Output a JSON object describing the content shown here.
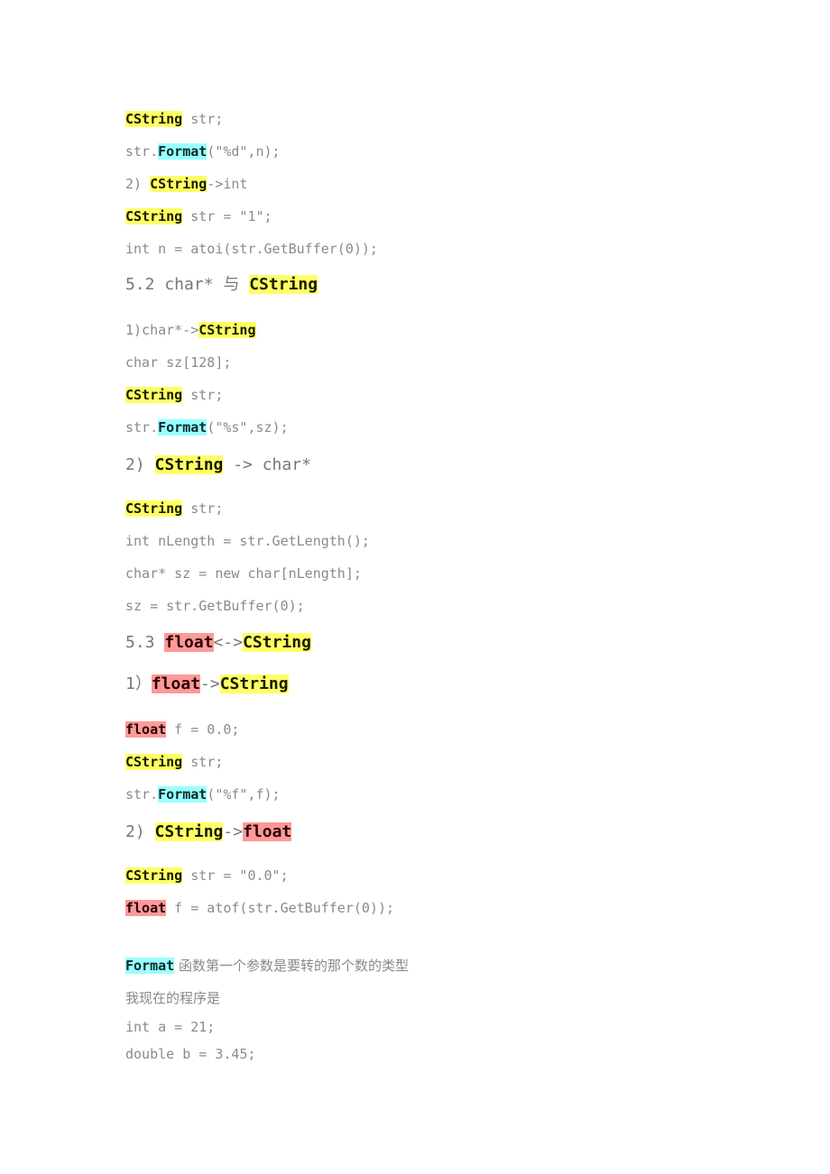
{
  "colors": {
    "cstring": "#ffff66",
    "format": "#99ffff",
    "float": "#ff9999",
    "text": "#8a8a8a"
  },
  "lines": [
    {
      "kind": "code",
      "segs": [
        {
          "t": "CString",
          "hl": "y"
        },
        {
          "t": " str;"
        }
      ]
    },
    {
      "kind": "code",
      "segs": [
        {
          "t": "str."
        },
        {
          "t": "Format",
          "hl": "c"
        },
        {
          "t": "(\"%d\",n);"
        }
      ]
    },
    {
      "kind": "code",
      "segs": [
        {
          "t": "2) "
        },
        {
          "t": "CString",
          "hl": "y"
        },
        {
          "t": "->int"
        }
      ]
    },
    {
      "kind": "code",
      "segs": [
        {
          "t": "CString",
          "hl": "y"
        },
        {
          "t": " str = \"1\";"
        }
      ]
    },
    {
      "kind": "code",
      "segs": [
        {
          "t": "int n = atoi(str.GetBuffer(0));"
        }
      ]
    },
    {
      "kind": "head",
      "segs": [
        {
          "t": "5.2 char* 与 "
        },
        {
          "t": "CString",
          "hl": "y"
        }
      ]
    },
    {
      "kind": "code",
      "segs": [
        {
          "t": "1)char*->"
        },
        {
          "t": "CString",
          "hl": "y"
        }
      ]
    },
    {
      "kind": "code",
      "segs": [
        {
          "t": "char sz[128];"
        }
      ]
    },
    {
      "kind": "code",
      "segs": [
        {
          "t": "CString",
          "hl": "y"
        },
        {
          "t": " str;"
        }
      ]
    },
    {
      "kind": "code",
      "segs": [
        {
          "t": "str."
        },
        {
          "t": "Format",
          "hl": "c"
        },
        {
          "t": "(\"%s\",sz);"
        }
      ]
    },
    {
      "kind": "head",
      "segs": [
        {
          "t": "2) "
        },
        {
          "t": "CString",
          "hl": "y"
        },
        {
          "t": " -> char*"
        }
      ]
    },
    {
      "kind": "code",
      "segs": [
        {
          "t": "CString",
          "hl": "y"
        },
        {
          "t": " str;"
        }
      ]
    },
    {
      "kind": "code",
      "segs": [
        {
          "t": "int nLength = str.GetLength();"
        }
      ]
    },
    {
      "kind": "code",
      "segs": [
        {
          "t": "char* sz = new char[nLength];"
        }
      ]
    },
    {
      "kind": "code",
      "segs": [
        {
          "t": "sz = str.GetBuffer(0);"
        }
      ]
    },
    {
      "kind": "head",
      "segs": [
        {
          "t": "5.3 "
        },
        {
          "t": "float",
          "hl": "r"
        },
        {
          "t": "<->"
        },
        {
          "t": "CString",
          "hl": "y"
        }
      ]
    },
    {
      "kind": "head",
      "segs": [
        {
          "t": "1）"
        },
        {
          "t": "float",
          "hl": "r"
        },
        {
          "t": "->"
        },
        {
          "t": "CString",
          "hl": "y"
        }
      ]
    },
    {
      "kind": "code",
      "segs": [
        {
          "t": "float",
          "hl": "r"
        },
        {
          "t": " f = 0.0;"
        }
      ]
    },
    {
      "kind": "code",
      "segs": [
        {
          "t": "CString",
          "hl": "y"
        },
        {
          "t": " str;"
        }
      ]
    },
    {
      "kind": "code",
      "segs": [
        {
          "t": "str."
        },
        {
          "t": "Format",
          "hl": "c"
        },
        {
          "t": "(\"%f\",f);"
        }
      ]
    },
    {
      "kind": "head",
      "segs": [
        {
          "t": "2) "
        },
        {
          "t": "CString",
          "hl": "y"
        },
        {
          "t": "->"
        },
        {
          "t": "float",
          "hl": "r"
        }
      ]
    },
    {
      "kind": "code",
      "segs": [
        {
          "t": "CString",
          "hl": "y"
        },
        {
          "t": " str = \"0.0\";"
        }
      ]
    },
    {
      "kind": "code",
      "segs": [
        {
          "t": "float",
          "hl": "r"
        },
        {
          "t": " f = atof(str.GetBuffer(0));"
        }
      ]
    },
    {
      "kind": "body",
      "segs": [
        {
          "t": "Format",
          "hl": "c"
        },
        {
          "t": " 函数第一个参数是要转的那个数的类型",
          "cjk": true
        }
      ]
    },
    {
      "kind": "body",
      "segs": [
        {
          "t": "我现在的程序是",
          "cjk": true
        }
      ]
    },
    {
      "kind": "body",
      "segs": [
        {
          "t": "int a = 21;"
        }
      ]
    },
    {
      "kind": "body",
      "segs": [
        {
          "t": "double b = 3.45;"
        }
      ]
    }
  ]
}
